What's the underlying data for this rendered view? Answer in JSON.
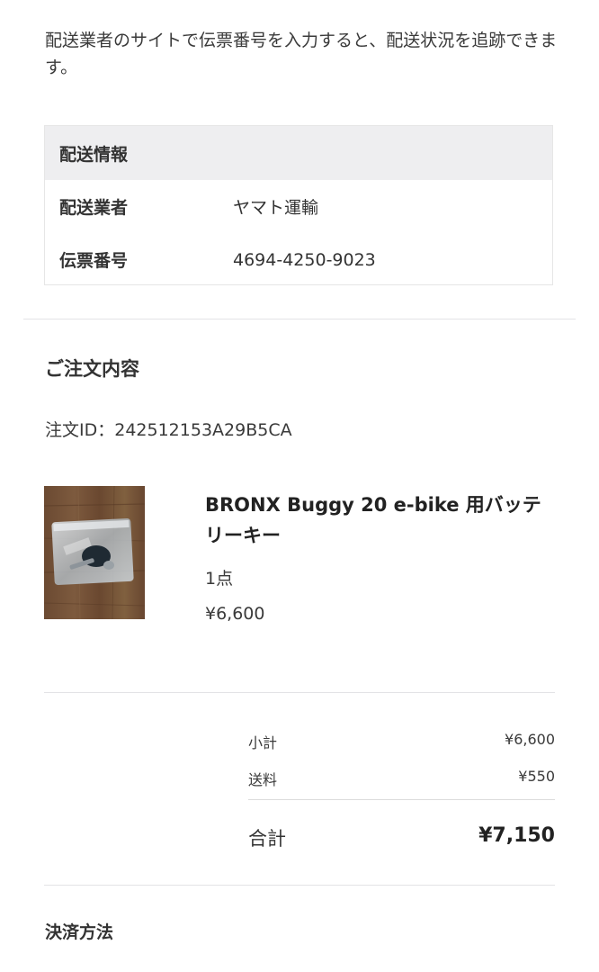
{
  "intro": "配送業者のサイトで伝票番号を入力すると、配送状況を追跡できます。",
  "shipping": {
    "header": "配送情報",
    "carrier_label": "配送業者",
    "carrier_value": "ヤマト運輸",
    "tracking_label": "伝票番号",
    "tracking_value": "4694-4250-9023"
  },
  "order": {
    "title": "ご注文内容",
    "id_text": "注文ID：242512153A29B5CA",
    "item": {
      "name": "BRONX Buggy 20 e-bike 用バッテリーキー",
      "quantity": "1点",
      "price": "¥6,600",
      "image_icon": "product-photo-key-in-bag"
    }
  },
  "summary": {
    "subtotal_label": "小計",
    "subtotal_value": "¥6,600",
    "shipping_label": "送料",
    "shipping_value": "¥550",
    "total_label": "合計",
    "total_value": "¥7,150"
  },
  "payment": {
    "title": "決済方法"
  }
}
